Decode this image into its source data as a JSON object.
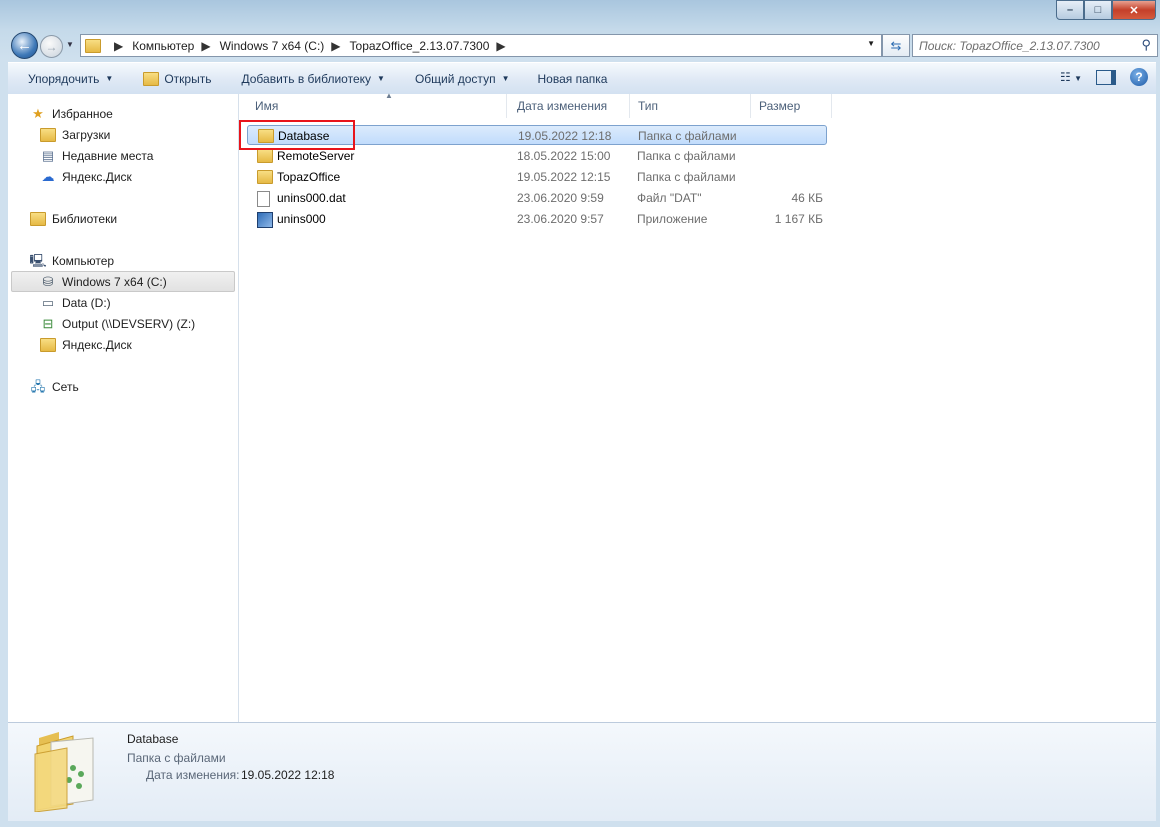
{
  "window": {
    "min_label": "–",
    "max_label": "□",
    "close_label": "✕"
  },
  "address": {
    "crumbs": [
      "Компьютер",
      "Windows 7 x64 (C:)",
      "TopazOffice_2.13.07.7300"
    ]
  },
  "search": {
    "placeholder": "Поиск: TopazOffice_2.13.07.7300"
  },
  "toolbar": {
    "organize": "Упорядочить",
    "open": "Открыть",
    "add_library": "Добавить в библиотеку",
    "share": "Общий доступ",
    "new_folder": "Новая папка"
  },
  "nav": {
    "favorites": "Избранное",
    "downloads": "Загрузки",
    "recent": "Недавние места",
    "yandex1": "Яндекс.Диск",
    "libraries": "Библиотеки",
    "computer": "Компьютер",
    "drive_c": "Windows 7 x64 (C:)",
    "drive_d": "Data (D:)",
    "drive_z": "Output (\\\\DEVSERV) (Z:)",
    "yandex2": "Яндекс.Диск",
    "network": "Сеть"
  },
  "columns": {
    "name": "Имя",
    "date": "Дата изменения",
    "type": "Тип",
    "size": "Размер"
  },
  "files": [
    {
      "name": "Database",
      "date": "19.05.2022 12:18",
      "type": "Папка с файлами",
      "size": "",
      "icon": "folder-icon"
    },
    {
      "name": "RemoteServer",
      "date": "18.05.2022 15:00",
      "type": "Папка с файлами",
      "size": "",
      "icon": "folder-icon"
    },
    {
      "name": "TopazOffice",
      "date": "19.05.2022 12:15",
      "type": "Папка с файлами",
      "size": "",
      "icon": "folder-icon"
    },
    {
      "name": "unins000.dat",
      "date": "23.06.2020 9:59",
      "type": "Файл \"DAT\"",
      "size": "46 КБ",
      "icon": "file-icon"
    },
    {
      "name": "unins000",
      "date": "23.06.2020 9:57",
      "type": "Приложение",
      "size": "1 167 КБ",
      "icon": "exe-icon"
    }
  ],
  "details": {
    "name": "Database",
    "type": "Папка с файлами",
    "date_label": "Дата изменения:",
    "date_value": "19.05.2022 12:18"
  },
  "colors": {
    "selection": "#c1dcfc",
    "highlight_box": "#e8141b"
  }
}
